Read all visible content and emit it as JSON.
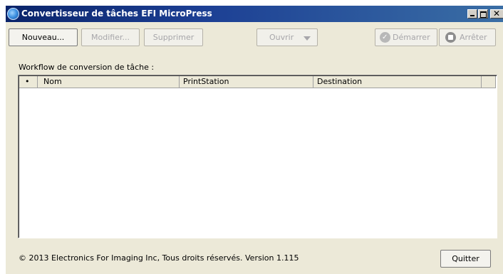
{
  "window": {
    "title": "Convertisseur de tâches EFI MicroPress"
  },
  "toolbar": {
    "nouveau_label": "Nouveau...",
    "modifier_label": "Modifier...",
    "supprimer_label": "Supprimer",
    "ouvrir_label": "Ouvrir",
    "demarrer_label": "Démarrer",
    "arreter_label": "Arrêter"
  },
  "workflow": {
    "label": "Workflow de conversion de tâche :",
    "columns": [
      "•",
      "Nom",
      "PrintStation",
      "Destination",
      ""
    ],
    "rows": []
  },
  "footer": {
    "copyright": "© 2013 Electronics For Imaging Inc, Tous droits réservés. Version 1.115",
    "quit_label": "Quitter"
  }
}
